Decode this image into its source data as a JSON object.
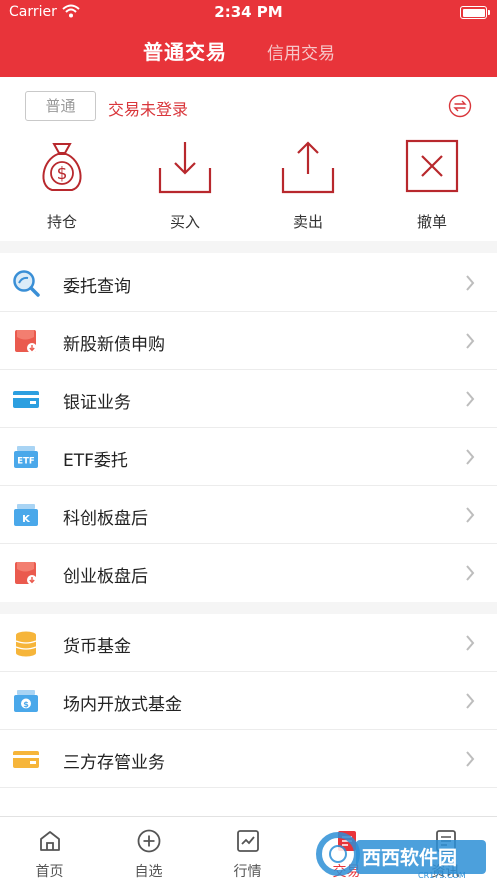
{
  "status_bar": {
    "carrier": "Carrier",
    "time": "2:34 PM"
  },
  "header": {
    "tabs": [
      "普通交易",
      "信用交易"
    ],
    "active_tab": 0,
    "brand_color": "#e8343a"
  },
  "account": {
    "type": "普通",
    "status": "交易未登录"
  },
  "actions": [
    {
      "label": "持仓",
      "icon": "money-bag-icon"
    },
    {
      "label": "买入",
      "icon": "download-icon"
    },
    {
      "label": "卖出",
      "icon": "upload-icon"
    },
    {
      "label": "撤单",
      "icon": "cancel-box-icon"
    }
  ],
  "menu_groups": [
    [
      {
        "label": "委托查询",
        "icon": "search-icon"
      },
      {
        "label": "新股新债申购",
        "icon": "red-bag-icon"
      },
      {
        "label": "银证业务",
        "icon": "card-icon"
      },
      {
        "label": "ETF委托",
        "icon": "etf-icon"
      },
      {
        "label": "科创板盘后",
        "icon": "kc-icon"
      },
      {
        "label": "创业板盘后",
        "icon": "red-bag-icon"
      }
    ],
    [
      {
        "label": "货币基金",
        "icon": "coins-icon"
      },
      {
        "label": "场内开放式基金",
        "icon": "fund-icon"
      },
      {
        "label": "三方存管业务",
        "icon": "yellow-card-icon"
      }
    ]
  ],
  "tabbar": [
    {
      "label": "首页",
      "icon": "home-icon"
    },
    {
      "label": "自选",
      "icon": "plus-circle-icon"
    },
    {
      "label": "行情",
      "icon": "chart-icon"
    },
    {
      "label": "交易",
      "icon": "trade-icon"
    },
    {
      "label": "资讯",
      "icon": "news-icon"
    }
  ],
  "active_tab_index": 3,
  "watermark": {
    "text": "西西软件园",
    "subtext": "CR173.COM"
  }
}
